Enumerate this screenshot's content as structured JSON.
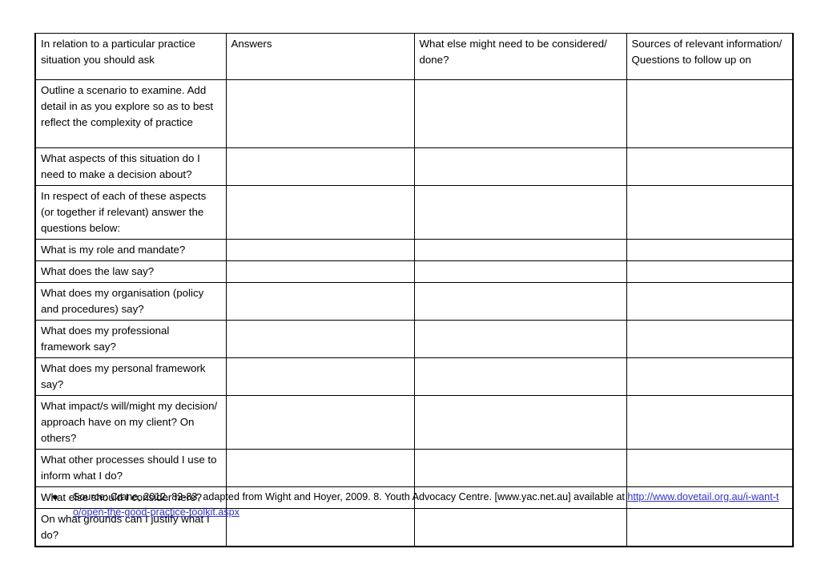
{
  "document": {
    "table": {
      "headers": [
        "In relation to a particular practice situation you should ask",
        "Answers",
        "What else might need to be considered/ done?",
        "Sources of relevant information/ Questions to follow up on"
      ],
      "rows": [
        {
          "prompt": "Outline a scenario to examine. Add detail in as you explore so as to best reflect the complexity of practice",
          "answers": "",
          "considered": "",
          "sources": ""
        },
        {
          "prompt": "What aspects of this situation do I need to make a decision about?",
          "answers": "",
          "considered": "",
          "sources": ""
        },
        {
          "prompt": "In respect of each of these aspects (or together if relevant) answer the questions below:",
          "answers": "",
          "considered": "",
          "sources": ""
        },
        {
          "prompt": "What is my role and mandate?",
          "answers": "",
          "considered": "",
          "sources": ""
        },
        {
          "prompt": "What does the law say?",
          "answers": "",
          "considered": "",
          "sources": ""
        },
        {
          "prompt": "What does my organisation (policy and procedures) say?",
          "answers": "",
          "considered": "",
          "sources": ""
        },
        {
          "prompt": "What does my professional framework say?",
          "answers": "",
          "considered": "",
          "sources": ""
        },
        {
          "prompt": "What does my personal framework say?",
          "answers": "",
          "considered": "",
          "sources": ""
        },
        {
          "prompt": "What impact/s will/might my decision/ approach have on my client? On others?",
          "answers": "",
          "considered": "",
          "sources": ""
        },
        {
          "prompt": "What other processes should I use to inform what I do?",
          "answers": "",
          "considered": "",
          "sources": ""
        },
        {
          "prompt": "What else should I consider here?",
          "answers": "",
          "considered": "",
          "sources": ""
        },
        {
          "prompt": "On what grounds can I justify what I do?",
          "answers": "",
          "considered": "",
          "sources": ""
        }
      ]
    },
    "footnote": {
      "bullet_glyph": "●",
      "source_text": "Source: Crane, 2012. 82-83, adapted from Wight and Hoyer, 2009. 8. Youth Advocacy Centre. [www.yac.net.au] available at ",
      "link_text": "http://www.dovetail.org.au/i-want-to/open-the-good-practice-toolkit.aspx",
      "link_color": "#3333CC"
    }
  }
}
